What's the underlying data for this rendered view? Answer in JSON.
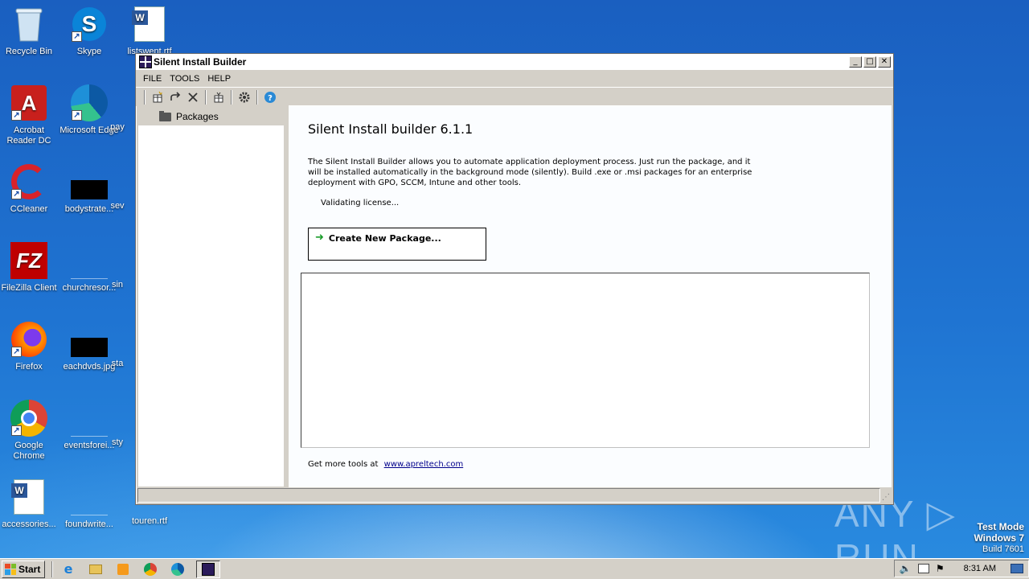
{
  "desktop": {
    "icons": [
      {
        "label": "Recycle Bin"
      },
      {
        "label": "Skype"
      },
      {
        "label": "listswent.rtf"
      },
      {
        "label": "Acrobat Reader DC"
      },
      {
        "label": "Microsoft Edge"
      },
      {
        "label": "pay"
      },
      {
        "label": "CCleaner"
      },
      {
        "label": "bodystrate..."
      },
      {
        "label": "sev"
      },
      {
        "label": "FileZilla Client"
      },
      {
        "label": "churchresor..."
      },
      {
        "label": "sin"
      },
      {
        "label": "Firefox"
      },
      {
        "label": "eachdvds.jpg"
      },
      {
        "label": "sta"
      },
      {
        "label": "Google Chrome"
      },
      {
        "label": "eventsforei..."
      },
      {
        "label": "sty"
      },
      {
        "label": "accessories..."
      },
      {
        "label": "foundwrite..."
      },
      {
        "label": "touren.rtf"
      }
    ]
  },
  "window": {
    "title": "Silent Install Builder",
    "controls": {
      "minimize": "_",
      "maximize": "□",
      "close": "✕"
    },
    "menu": [
      "FILE",
      "TOOLS",
      "HELP"
    ],
    "tree": {
      "root_label": "Packages"
    },
    "main": {
      "heading": "Silent Install builder 6.1.1",
      "description": "The Silent Install Builder allows you to automate application deployment process. Just run the package, and it will be installed automatically in the background mode (silently).  Build .exe or .msi packages for an enterprise deployment with GPO, SCCM, Intune and other tools.",
      "status": "Validating license...",
      "create_button": "Create New Package...",
      "footer_text": "Get more tools at",
      "footer_link": "www.apreltech.com"
    }
  },
  "watermark": {
    "text": "ANY ▷ RUN"
  },
  "test_mode": {
    "line1": "Test Mode",
    "line2": "Windows 7",
    "line3": "Build 7601"
  },
  "taskbar": {
    "start_label": "Start",
    "clock": "8:31 AM"
  }
}
